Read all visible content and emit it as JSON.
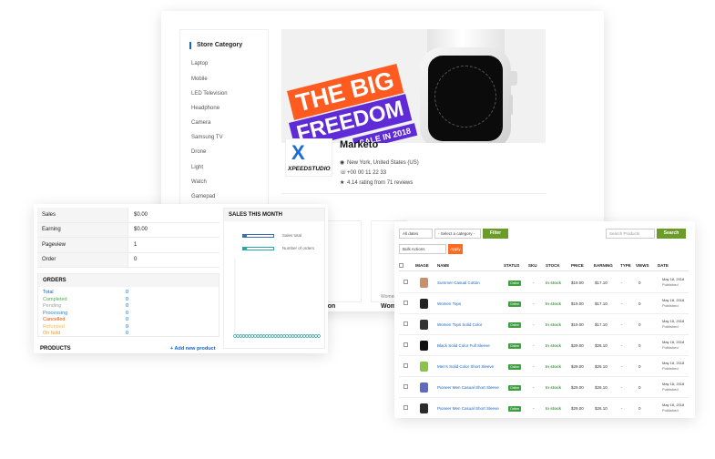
{
  "store": {
    "category_title": "Store Category",
    "categories": [
      "Laptop",
      "Mobile",
      "LED Television",
      "Headphone",
      "Camera",
      "Samsung TV",
      "Drone",
      "Light",
      "Watch",
      "Gamepad"
    ],
    "banner": {
      "line1": "THE BIG",
      "line2": "FREEDOM",
      "line3": "SALE IN 2018"
    },
    "logo": {
      "mark": "X",
      "text": "XPEEDSTUDIO"
    },
    "shop_name": "Marketo",
    "location": "New York, United States (US)",
    "phone": "+00 00 11 22 33",
    "rating": "4.14 rating from 71 reviews",
    "fragment_1": "al Cotton",
    "fragment_2": "Wome",
    "fragment_3": "Women"
  },
  "dashboard": {
    "stats": [
      {
        "label": "Sales",
        "value": "$0.00"
      },
      {
        "label": "Earning",
        "value": "$0.00"
      },
      {
        "label": "Pageview",
        "value": "1"
      },
      {
        "label": "Order",
        "value": "0"
      }
    ],
    "orders_title": "ORDERS",
    "orders": [
      {
        "label": "Total",
        "value": "0",
        "color": "#1565c0"
      },
      {
        "label": "Completed",
        "value": "0",
        "color": "#4caf50"
      },
      {
        "label": "Pending",
        "value": "0",
        "color": "#9e9e9e"
      },
      {
        "label": "Processing",
        "value": "0",
        "color": "#1e88e5"
      },
      {
        "label": "Cancelled",
        "value": "0",
        "color": "#e65100"
      },
      {
        "label": "Refunded",
        "value": "0",
        "color": "#ffb74d"
      },
      {
        "label": "On hold",
        "value": "0",
        "color": "#ff9800"
      }
    ],
    "products_title": "PRODUCTS",
    "add_new": "+ Add new product",
    "sales_title": "SALES THIS MONTH",
    "legend": [
      "Sales total",
      "Number of orders"
    ]
  },
  "chart_data": {
    "type": "line",
    "title": "SALES THIS MONTH",
    "series": [
      {
        "name": "Sales total",
        "values": [
          0,
          0,
          0,
          0,
          0,
          0,
          0,
          0,
          0,
          0,
          0,
          0,
          0,
          0,
          0,
          0,
          0,
          0,
          0,
          0,
          0,
          0,
          0,
          0,
          0,
          0,
          0,
          0,
          0,
          0
        ]
      },
      {
        "name": "Number of orders",
        "values": [
          0,
          0,
          0,
          0,
          0,
          0,
          0,
          0,
          0,
          0,
          0,
          0,
          0,
          0,
          0,
          0,
          0,
          0,
          0,
          0,
          0,
          0,
          0,
          0,
          0,
          0,
          0,
          0,
          0,
          0
        ]
      }
    ],
    "grid": false
  },
  "products": {
    "status_select": "All dates",
    "category_select": "- Select a category -",
    "filter_label": "Filter",
    "search_placeholder": "Search Products",
    "search_label": "Search",
    "bulk_label": "Bulk Actions",
    "apply_label": "Apply",
    "headers": [
      "IMAGE",
      "NAME",
      "STATUS",
      "SKU",
      "STOCK",
      "PRICE",
      "EARNING",
      "TYPE",
      "VIEWS",
      "DATE"
    ],
    "rows": [
      {
        "name": "Summer Casual Cotton",
        "status": "Online",
        "sku": "-",
        "stock": "In stock",
        "price": "$19.00",
        "earning": "$17.10",
        "type": "-",
        "views": "0",
        "date": "May 18, 2018",
        "published": "Published",
        "thumb": "#c98f6a"
      },
      {
        "name": "Women Tops",
        "status": "Online",
        "sku": "-",
        "stock": "In stock",
        "price": "$19.00",
        "earning": "$17.10",
        "type": "-",
        "views": "0",
        "date": "May 18, 2018",
        "published": "Published",
        "thumb": "#222222"
      },
      {
        "name": "Women Tops Solid Color",
        "status": "Online",
        "sku": "-",
        "stock": "In stock",
        "price": "$19.00",
        "earning": "$17.10",
        "type": "-",
        "views": "0",
        "date": "May 18, 2018",
        "published": "Published",
        "thumb": "#333333"
      },
      {
        "name": "Black Solid Color Full Sleeve",
        "status": "Online",
        "sku": "-",
        "stock": "In stock",
        "price": "$29.00",
        "earning": "$26.10",
        "type": "-",
        "views": "0",
        "date": "May 18, 2018",
        "published": "Published",
        "thumb": "#111111"
      },
      {
        "name": "Men's Solid Color Short Sleeve",
        "status": "Online",
        "sku": "-",
        "stock": "In stock",
        "price": "$29.00",
        "earning": "$26.10",
        "type": "-",
        "views": "0",
        "date": "May 18, 2018",
        "published": "Published",
        "thumb": "#8bc34a"
      },
      {
        "name": "Pioneer Men Casual Short Sleeve",
        "status": "Online",
        "sku": "-",
        "stock": "In stock",
        "price": "$29.00",
        "earning": "$26.10",
        "type": "-",
        "views": "0",
        "date": "May 18, 2018",
        "published": "Published",
        "thumb": "#5c6bc0"
      },
      {
        "name": "Pioneer Men Casual Short Sleeve",
        "status": "Online",
        "sku": "-",
        "stock": "In stock",
        "price": "$29.00",
        "earning": "$26.10",
        "type": "-",
        "views": "0",
        "date": "May 18, 2018",
        "published": "Published",
        "thumb": "#2b2b2b"
      }
    ]
  }
}
